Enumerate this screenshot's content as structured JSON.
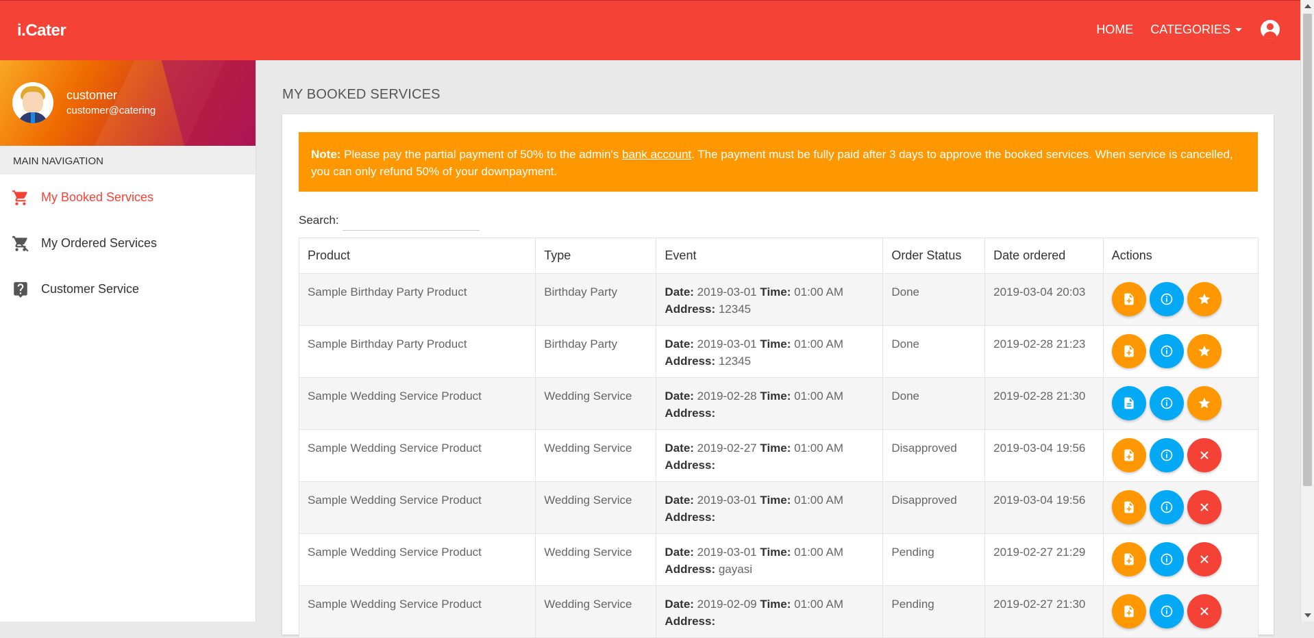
{
  "header": {
    "brand": "i.Cater",
    "nav": {
      "home": "HOME",
      "categories": "CATEGORIES"
    }
  },
  "sidebar": {
    "user": {
      "name": "customer",
      "email": "customer@catering"
    },
    "nav_header": "MAIN NAVIGATION",
    "items": [
      {
        "label": "My Booked Services",
        "icon": "cart-icon",
        "active": true
      },
      {
        "label": "My Ordered Services",
        "icon": "cart-off-icon",
        "active": false
      },
      {
        "label": "Customer Service",
        "icon": "help-icon",
        "active": false
      }
    ]
  },
  "main": {
    "title": "MY BOOKED SERVICES",
    "note": {
      "label": "Note:",
      "text_before": " Please pay the partial payment of 50% to the admin's ",
      "link": "bank account",
      "text_after": ". The payment must be fully paid after 3 days to approve the booked services. When service is cancelled, you can only refund 50% of your downpayment."
    },
    "search_label": "Search:",
    "table": {
      "headers": [
        "Product",
        "Type",
        "Event",
        "Order Status",
        "Date ordered",
        "Actions"
      ],
      "date_label": "Date:",
      "time_label": "Time:",
      "address_label": "Address:",
      "rows": [
        {
          "product": "Sample Birthday Party Product",
          "type": "Birthday Party",
          "date": "2019-03-01",
          "time": "01:00 AM",
          "address": "12345",
          "status": "Done",
          "ordered": "2019-03-04 20:03",
          "actions": [
            "invoice-add",
            "info",
            "rate"
          ]
        },
        {
          "product": "Sample Birthday Party Product",
          "type": "Birthday Party",
          "date": "2019-03-01",
          "time": "01:00 AM",
          "address": "12345",
          "status": "Done",
          "ordered": "2019-02-28 21:23",
          "actions": [
            "invoice-add",
            "info",
            "rate"
          ]
        },
        {
          "product": "Sample Wedding Service Product",
          "type": "Wedding Service",
          "date": "2019-02-28",
          "time": "01:00 AM",
          "address": "",
          "status": "Done",
          "ordered": "2019-02-28 21:30",
          "actions": [
            "invoice-view",
            "info",
            "rate"
          ]
        },
        {
          "product": "Sample Wedding Service Product",
          "type": "Wedding Service",
          "date": "2019-02-27",
          "time": "01:00 AM",
          "address": "",
          "status": "Disapproved",
          "ordered": "2019-03-04 19:56",
          "actions": [
            "invoice-add",
            "info",
            "cancel"
          ]
        },
        {
          "product": "Sample Wedding Service Product",
          "type": "Wedding Service",
          "date": "2019-03-01",
          "time": "01:00 AM",
          "address": "",
          "status": "Disapproved",
          "ordered": "2019-03-04 19:56",
          "actions": [
            "invoice-add",
            "info",
            "cancel"
          ]
        },
        {
          "product": "Sample Wedding Service Product",
          "type": "Wedding Service",
          "date": "2019-03-01",
          "time": "01:00 AM",
          "address": "gayasi",
          "status": "Pending",
          "ordered": "2019-02-27 21:29",
          "actions": [
            "invoice-add",
            "info",
            "cancel"
          ]
        },
        {
          "product": "Sample Wedding Service Product",
          "type": "Wedding Service",
          "date": "2019-02-09",
          "time": "01:00 AM",
          "address": "",
          "status": "Pending",
          "ordered": "2019-02-27 21:30",
          "actions": [
            "invoice-add",
            "info",
            "cancel"
          ]
        }
      ]
    }
  },
  "colors": {
    "header": "#f44336",
    "note": "#ff9800",
    "btn_orange": "#ff9800",
    "btn_blue": "#03a9f4",
    "btn_red": "#f44336",
    "active_nav": "#f44336"
  }
}
